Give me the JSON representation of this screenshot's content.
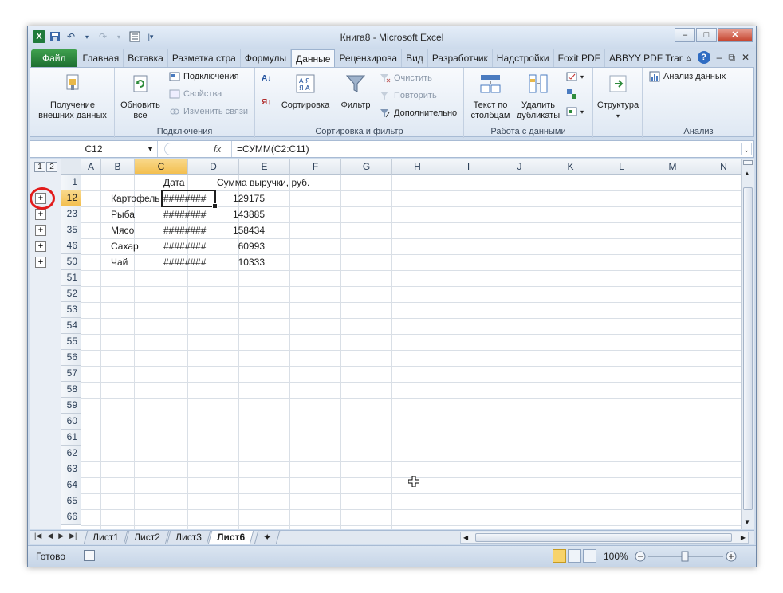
{
  "window": {
    "title": "Книга8 - Microsoft Excel",
    "min_label": "▭",
    "max_label": "□",
    "close_label": "✕"
  },
  "ribbon_tabs": [
    {
      "label": "Файл"
    },
    {
      "label": "Главная"
    },
    {
      "label": "Вставка"
    },
    {
      "label": "Разметка стра"
    },
    {
      "label": "Формулы"
    },
    {
      "label": "Данные"
    },
    {
      "label": "Рецензирова"
    },
    {
      "label": "Вид"
    },
    {
      "label": "Разработчик"
    },
    {
      "label": "Надстройки"
    },
    {
      "label": "Foxit PDF"
    },
    {
      "label": "ABBYY PDF Trar"
    }
  ],
  "ribbon": {
    "get_external": "Получение внешних данных",
    "refresh_all": "Обновить все",
    "connections": "Подключения",
    "properties": "Свойства",
    "edit_links": "Изменить связи",
    "connections_group": "Подключения",
    "sort": "Сортировка",
    "filter": "Фильтр",
    "clear": "Очистить",
    "reapply": "Повторить",
    "advanced": "Дополнительно",
    "sort_filter_group": "Сортировка и фильтр",
    "text_to_columns": "Текст по столбцам",
    "remove_duplicates": "Удалить дубликаты",
    "data_tools_group": "Работа с данными",
    "outline": "Структура",
    "data_analysis": "Анализ данных",
    "analysis_group": "Анализ"
  },
  "formula_bar": {
    "name_box": "C12",
    "fx": "fx",
    "formula": "=СУММ(C2:C11)"
  },
  "outline_levels": [
    "1",
    "2"
  ],
  "columns": [
    "A",
    "B",
    "C",
    "D",
    "E",
    "F",
    "G",
    "H",
    "I",
    "J",
    "K",
    "L",
    "M",
    "N"
  ],
  "selected_column": "C",
  "rows": [
    "1",
    "12",
    "23",
    "35",
    "46",
    "50",
    "51",
    "52",
    "53",
    "54",
    "55",
    "56",
    "57",
    "58",
    "59",
    "60",
    "61",
    "62",
    "63",
    "64",
    "65",
    "66"
  ],
  "selected_row": "12",
  "cells": {
    "c1": "Дата",
    "d1": "Сумма выручки, руб.",
    "r12": {
      "a": "Картофель",
      "c": "########",
      "d": "129175"
    },
    "r23": {
      "a": "Рыба",
      "c": "########",
      "d": "143885"
    },
    "r35": {
      "a": "Мясо",
      "c": "########",
      "d": "158434"
    },
    "r46": {
      "a": "Сахар",
      "c": "########",
      "d": "60993"
    },
    "r50": {
      "a": "Чай",
      "c": "########",
      "d": "10333"
    }
  },
  "expand_buttons": [
    "+",
    "+",
    "+",
    "+",
    "+"
  ],
  "sheet_tabs": [
    {
      "label": "Лист1"
    },
    {
      "label": "Лист2"
    },
    {
      "label": "Лист3"
    },
    {
      "label": "Лист6"
    }
  ],
  "active_sheet": "Лист6",
  "status": {
    "ready": "Готово",
    "zoom": "100%"
  },
  "colors": {
    "file_tab": "#1d6f31",
    "selection_header": "#f3bf4f",
    "highlight_circle": "#e21b1b"
  }
}
